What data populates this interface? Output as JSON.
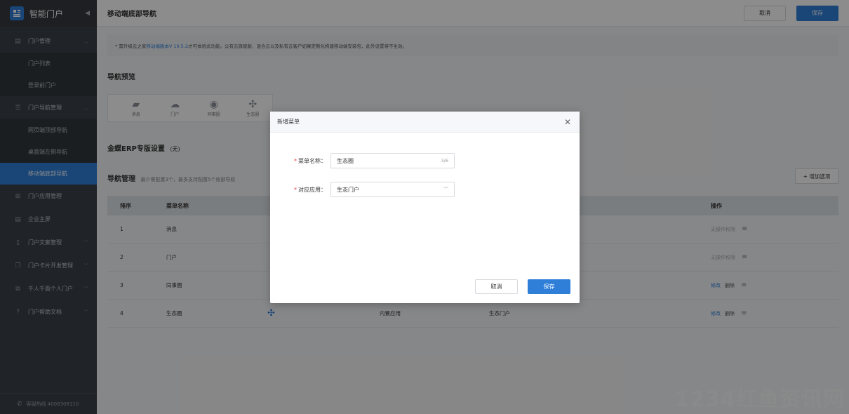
{
  "sidebar": {
    "app_title": "智能门户",
    "collapse_icon": "chevron-left-icon",
    "items": [
      {
        "label": "门户管理",
        "icon": "document-icon"
      },
      {
        "label": "门户列表"
      },
      {
        "label": "登录前门户"
      },
      {
        "label": "门户导航管理",
        "icon": "list-icon"
      },
      {
        "label": "网页端顶部导航"
      },
      {
        "label": "桌面端左侧导航"
      },
      {
        "label": "移动端底部导航"
      },
      {
        "label": "门户应用管理",
        "icon": "grid-icon"
      },
      {
        "label": "企业主屏",
        "icon": "document-icon"
      },
      {
        "label": "门户文案管理",
        "icon": "file-icon"
      },
      {
        "label": "门户卡片开发管理",
        "icon": "card-icon"
      },
      {
        "label": "千人千面个人门户",
        "icon": "users-icon"
      },
      {
        "label": "门户帮助文档",
        "icon": "help-icon"
      }
    ],
    "footer": "客服热线 4008308110"
  },
  "header": {
    "title": "移动端底部导航",
    "cancel_label": "取消",
    "save_label": "保存"
  },
  "notice": {
    "prefix": "* 需升级云之家",
    "link": "移动端版本V 10.5.2",
    "suffix": "才可体验此功能。公有云旗舰版、混合云以及私有云客户如果定制化构建移动端安装包，此外设置将不生效。"
  },
  "preview": {
    "title": "导航预览",
    "items": [
      {
        "label": "消息",
        "icon": "chat-icon"
      },
      {
        "label": "门户",
        "icon": "cloud-icon"
      },
      {
        "label": "同事圈",
        "icon": "circle-icon"
      },
      {
        "label": "生态圈",
        "icon": "ecosystem-icon"
      }
    ]
  },
  "erp": {
    "title": "金蝶ERP专版设置",
    "note": "(无)"
  },
  "nav_manage": {
    "title": "导航管理",
    "subtitle": "最少需配置3个，最多支持配置5个底部导航",
    "add_label": "+ 增加选项",
    "columns": [
      "排序",
      "菜单名称",
      "",
      "",
      "",
      "操作"
    ],
    "rows": [
      {
        "seq": "1",
        "name": "消息",
        "type": "",
        "app": "",
        "op1": "无操作权限",
        "op2": ""
      },
      {
        "seq": "2",
        "name": "门户",
        "type": "",
        "app": "",
        "op1": "无操作权限",
        "op2": ""
      },
      {
        "seq": "3",
        "name": "同事圈",
        "type": "",
        "app": "",
        "op1": "修改",
        "op2": "删除"
      },
      {
        "seq": "4",
        "name": "生态圈",
        "type": "内置应用",
        "app": "生态门户",
        "op1": "修改",
        "op2": "删除"
      }
    ]
  },
  "modal": {
    "title": "新增菜单",
    "name_label": "菜单名称：",
    "name_value": "生态圈",
    "name_count": "3/6",
    "app_label": "对应应用：",
    "app_value": "生态门户",
    "cancel_label": "取消",
    "save_label": "保存"
  },
  "watermark": "1234红鱼资讯网",
  "colors": {
    "primary": "#2f7fd9",
    "sidebar": "#3b4148"
  }
}
